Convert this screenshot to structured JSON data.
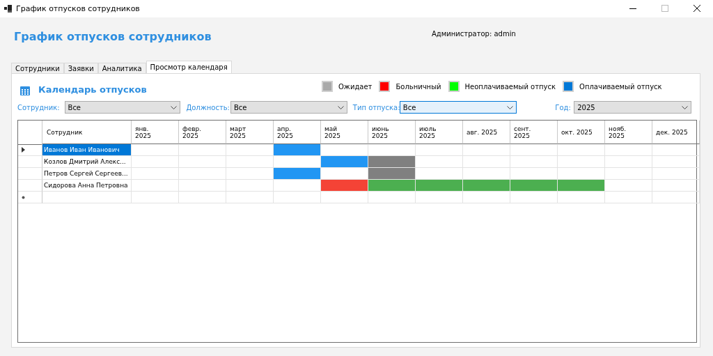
{
  "window": {
    "title": "График отпусков сотрудников"
  },
  "header": {
    "title": "График отпусков сотрудников",
    "user": "Администратор: admin"
  },
  "tabs": [
    {
      "label": "Сотрудники",
      "selected": false
    },
    {
      "label": "Заявки",
      "selected": false
    },
    {
      "label": "Аналитика",
      "selected": false
    },
    {
      "label": "Просмотр календаря",
      "selected": true
    }
  ],
  "calendar": {
    "title": "Календарь отпусков",
    "legend": [
      {
        "label": "Ожидает",
        "color": "#a9a9a9"
      },
      {
        "label": "Больничный",
        "color": "#ff0000"
      },
      {
        "label": "Неоплачиваемый отпуск",
        "color": "#00ff00"
      },
      {
        "label": "Оплачиваемый отпуск",
        "color": "#0078d7"
      }
    ],
    "filters": [
      {
        "label": "Сотрудник:",
        "value": "Все",
        "focused": false
      },
      {
        "label": "Должность:",
        "value": "Все",
        "focused": false
      },
      {
        "label": "Тип отпуска:",
        "value": "Все",
        "focused": true
      },
      {
        "label": "Год:",
        "value": "2025",
        "focused": false
      }
    ],
    "table": {
      "columns": [
        "Сотрудник",
        "янв.\n2025",
        "февр.\n2025",
        "март\n2025",
        "апр.\n2025",
        "май\n2025",
        "июнь\n2025",
        "июль\n2025",
        "авг. 2025",
        "сент.\n2025",
        "окт. 2025",
        "нояб.\n2025",
        "дек. 2025"
      ],
      "rows": [
        {
          "name": "Иванов Иван Иванович",
          "selected": true,
          "cells": [
            {
              "kind": "none"
            },
            {
              "kind": "none"
            },
            {
              "kind": "none"
            },
            {
              "kind": "paid"
            },
            {
              "kind": "none"
            },
            {
              "kind": "none"
            },
            {
              "kind": "none"
            },
            {
              "kind": "none"
            },
            {
              "kind": "none"
            },
            {
              "kind": "none"
            },
            {
              "kind": "none"
            },
            {
              "kind": "none"
            }
          ]
        },
        {
          "name": "Козлов Дмитрий Алекс...",
          "selected": false,
          "cells": [
            {
              "kind": "none"
            },
            {
              "kind": "none"
            },
            {
              "kind": "none"
            },
            {
              "kind": "none"
            },
            {
              "kind": "paid"
            },
            {
              "kind": "pending"
            },
            {
              "kind": "none"
            },
            {
              "kind": "none"
            },
            {
              "kind": "none"
            },
            {
              "kind": "none"
            },
            {
              "kind": "none"
            },
            {
              "kind": "none"
            }
          ]
        },
        {
          "name": "Петров Сергей Сергеев...",
          "selected": false,
          "cells": [
            {
              "kind": "none"
            },
            {
              "kind": "none"
            },
            {
              "kind": "none"
            },
            {
              "kind": "paid"
            },
            {
              "kind": "none"
            },
            {
              "kind": "pending"
            },
            {
              "kind": "none"
            },
            {
              "kind": "none"
            },
            {
              "kind": "none"
            },
            {
              "kind": "none"
            },
            {
              "kind": "none"
            },
            {
              "kind": "none"
            }
          ]
        },
        {
          "name": "Сидорова Анна Петровна",
          "selected": false,
          "cells": [
            {
              "kind": "none"
            },
            {
              "kind": "none"
            },
            {
              "kind": "none"
            },
            {
              "kind": "none"
            },
            {
              "kind": "sick"
            },
            {
              "kind": "unpaid"
            },
            {
              "kind": "unpaid"
            },
            {
              "kind": "unpaid"
            },
            {
              "kind": "unpaid"
            },
            {
              "kind": "unpaid"
            },
            {
              "kind": "none"
            },
            {
              "kind": "none"
            }
          ]
        }
      ]
    }
  }
}
